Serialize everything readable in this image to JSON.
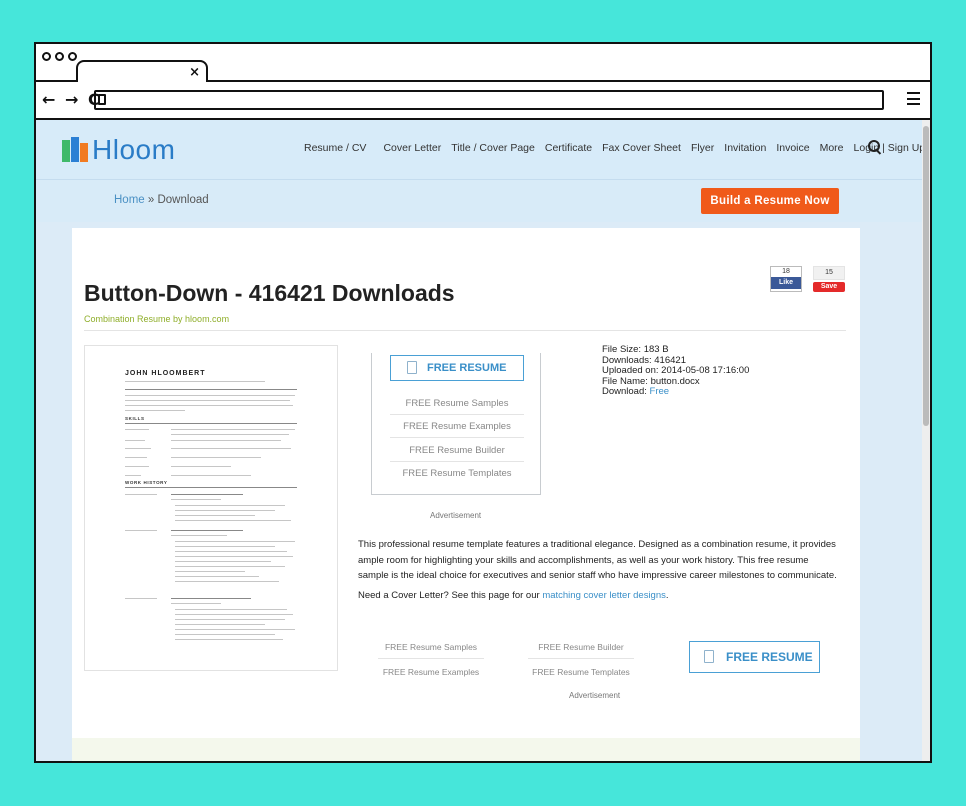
{
  "browser": {
    "tab_close_glyph": "×",
    "nav_glyphs": "← → C"
  },
  "site": {
    "logo_text": "Hloom",
    "nav": [
      "Resume / CV",
      "Cover Letter",
      "Title / Cover Page",
      "Certificate",
      "Fax Cover Sheet",
      "Flyer",
      "Invitation",
      "Invoice",
      "More",
      "Login | Sign Up"
    ],
    "colors": {
      "accent": "#2a7cc7",
      "cta": "#f05a1a",
      "header_bg": "#d7ebf9",
      "subtitle": "#8fae2a"
    }
  },
  "breadcrumb": {
    "home": "Home",
    "separator": " » ",
    "current": "Download"
  },
  "cta": {
    "label": "Build a Resume Now"
  },
  "social": {
    "fb_count": "18",
    "fb_label": "Like",
    "pin_count": "15",
    "pin_label": "Save"
  },
  "page": {
    "title": "Button-Down - 416421 Downloads",
    "subtitle": "Combination Resume by hloom.com"
  },
  "thumbnail": {
    "name": "JOHN HLOOMBERT",
    "section_skills": "SKILLS",
    "section_work": "WORK HISTORY"
  },
  "ad_block_1": {
    "button": "FREE RESUME",
    "links": [
      "FREE Resume Samples",
      "FREE Resume Examples",
      "FREE Resume Builder",
      "FREE Resume Templates"
    ],
    "label": "Advertisement"
  },
  "file_info": {
    "size": "File Size: 183 B",
    "downloads": "Downloads: 416421",
    "uploaded": "Uploaded on: 2014-05-08 17:16:00",
    "file_name": "File Name: button.docx",
    "download_label": "Download: ",
    "download_link": "Free"
  },
  "description": "This professional resume template features a traditional elegance. Designed as a combination resume, it provides ample room for highlighting your skills and accomplishments, as well as your work history. This free resume sample is the ideal choice for executives and senior staff who have impressive career milestones to communicate.",
  "cover_letter": {
    "text": "Need a Cover Letter? See this page for our ",
    "link": "matching cover letter designs",
    "suffix": "."
  },
  "ad_block_2": {
    "links": [
      "FREE Resume Samples",
      "FREE Resume Builder",
      "FREE Resume Examples",
      "FREE Resume Templates"
    ],
    "button": "FREE RESUME",
    "label": "Advertisement"
  }
}
